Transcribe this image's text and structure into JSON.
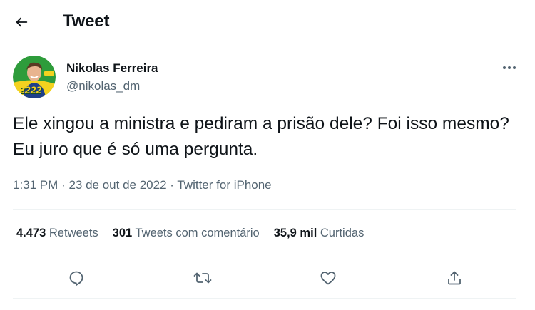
{
  "header": {
    "title": "Tweet",
    "back_icon": "arrow-left-icon"
  },
  "author": {
    "name": "Nikolas Ferreira",
    "handle": "@nikolas_dm",
    "avatar_badge": "2222"
  },
  "tweet": {
    "text": "Ele xingou a ministra e pediram a prisão dele? Foi isso mesmo? Eu juro que é só uma pergunta.",
    "time": "1:31 PM",
    "date": "23 de out de 2022",
    "source": "Twitter for iPhone",
    "separator": "·"
  },
  "stats": {
    "retweets_count": "4.473",
    "retweets_label": "Retweets",
    "quotes_count": "301",
    "quotes_label": "Tweets com comentário",
    "likes_count": "35,9 mil",
    "likes_label": "Curtidas"
  },
  "actions": [
    {
      "icon": "reply-icon"
    },
    {
      "icon": "retweet-icon"
    },
    {
      "icon": "like-icon"
    },
    {
      "icon": "share-icon"
    }
  ],
  "colors": {
    "text": "#0f1419",
    "secondary": "#536471",
    "divider": "#eff3f4",
    "avatar_green": "#2e9c3b",
    "avatar_yellow": "#f4d21f"
  }
}
